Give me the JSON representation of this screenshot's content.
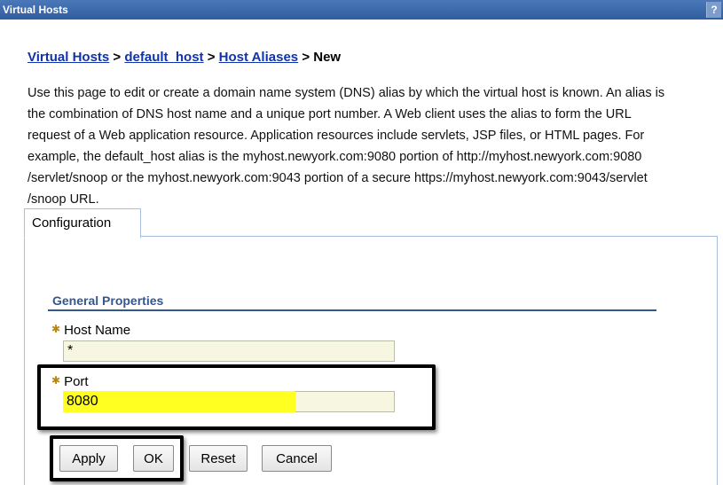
{
  "window": {
    "title": "Virtual Hosts",
    "help_label": "?"
  },
  "breadcrumb": {
    "items": [
      "Virtual Hosts",
      "default_host",
      "Host Aliases"
    ],
    "separator": ">",
    "current": "New"
  },
  "description": {
    "lines": [
      "Use this page to edit or create a domain name system (DNS) alias by which the virtual host is known. An alias is",
      "the combination of DNS host name and a unique port number. A Web client uses the alias to form the URL",
      "request of a Web application resource. Application resources include servlets, JSP files, or HTML pages. For",
      "example, the default_host alias is the myhost.newyork.com:9080 portion of http://myhost.newyork.com:9080",
      "/servlet/snoop or the myhost.newyork.com:9043 portion of a secure https://myhost.newyork.com:9043/servlet",
      "/snoop URL."
    ]
  },
  "tabs": {
    "configuration_label": "Configuration"
  },
  "form": {
    "section_title": "General Properties",
    "required_marker": "✱",
    "host_name": {
      "label": "Host Name",
      "value": "*"
    },
    "port": {
      "label": "Port",
      "value": "8080"
    }
  },
  "buttons": {
    "apply": "Apply",
    "ok": "OK",
    "reset": "Reset",
    "cancel": "Cancel"
  },
  "colors": {
    "titlebar": "#2f5d9e",
    "link": "#1133aa",
    "section_heading": "#33578e",
    "field_background": "#f7f7e1",
    "port_highlight": "#ffff22"
  }
}
